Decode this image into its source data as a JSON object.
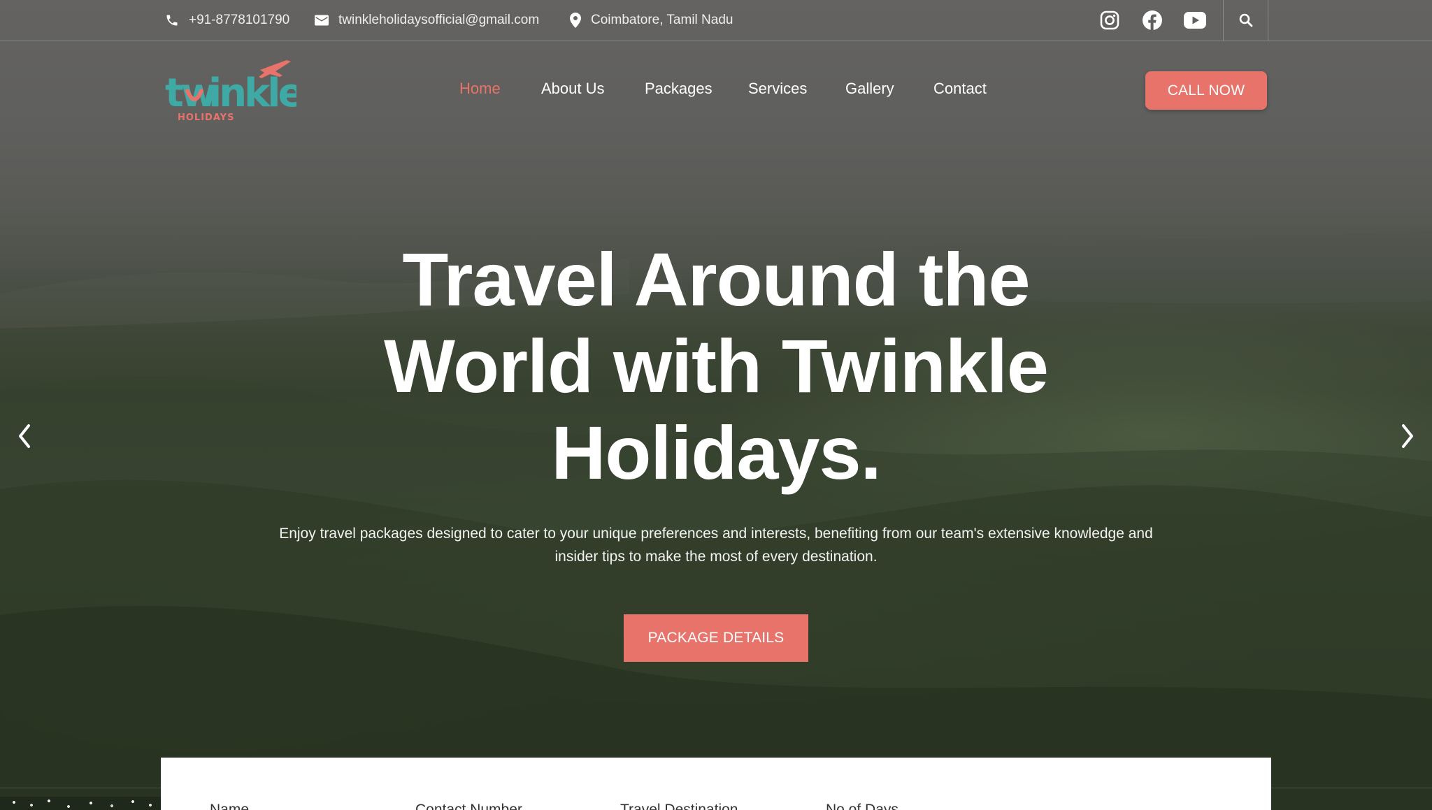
{
  "topbar": {
    "phone": "+91-8778101790",
    "email": "twinkleholidaysofficial@gmail.com",
    "location": "Coimbatore, Tamil Nadu",
    "social_icons": [
      "instagram-icon",
      "facebook-icon",
      "youtube-icon"
    ],
    "search_icon": "search-icon"
  },
  "logo": {
    "text": "twinkle",
    "tagline": "HOLIDAYS"
  },
  "nav": {
    "items": [
      {
        "label": "Home",
        "active": true
      },
      {
        "label": "About Us",
        "active": false
      },
      {
        "label": "Packages",
        "active": false
      },
      {
        "label": "Services",
        "active": false
      },
      {
        "label": "Gallery",
        "active": false
      },
      {
        "label": "Contact",
        "active": false
      }
    ],
    "cta_label": "CALL NOW"
  },
  "hero": {
    "title_line1": "Travel Around the",
    "title_line2": "World with Twinkle",
    "title_line3": "Holidays.",
    "subtitle_line1": "Enjoy travel packages designed to cater to your unique preferences and interests, benefiting from our team's extensive knowledge and",
    "subtitle_line2": "insider tips to make the most of every destination.",
    "button_label": "PACKAGE DETAILS",
    "prev_icon": "chevron-left-icon",
    "next_icon": "chevron-right-icon"
  },
  "form": {
    "labels": [
      "Name",
      "Contact Number",
      "Travel Destination",
      "No of Days"
    ]
  },
  "colors": {
    "accent": "#e8736b",
    "logo_teal": "#3fa9a5",
    "logo_coral": "#e8736b",
    "text_white": "#ffffff"
  }
}
